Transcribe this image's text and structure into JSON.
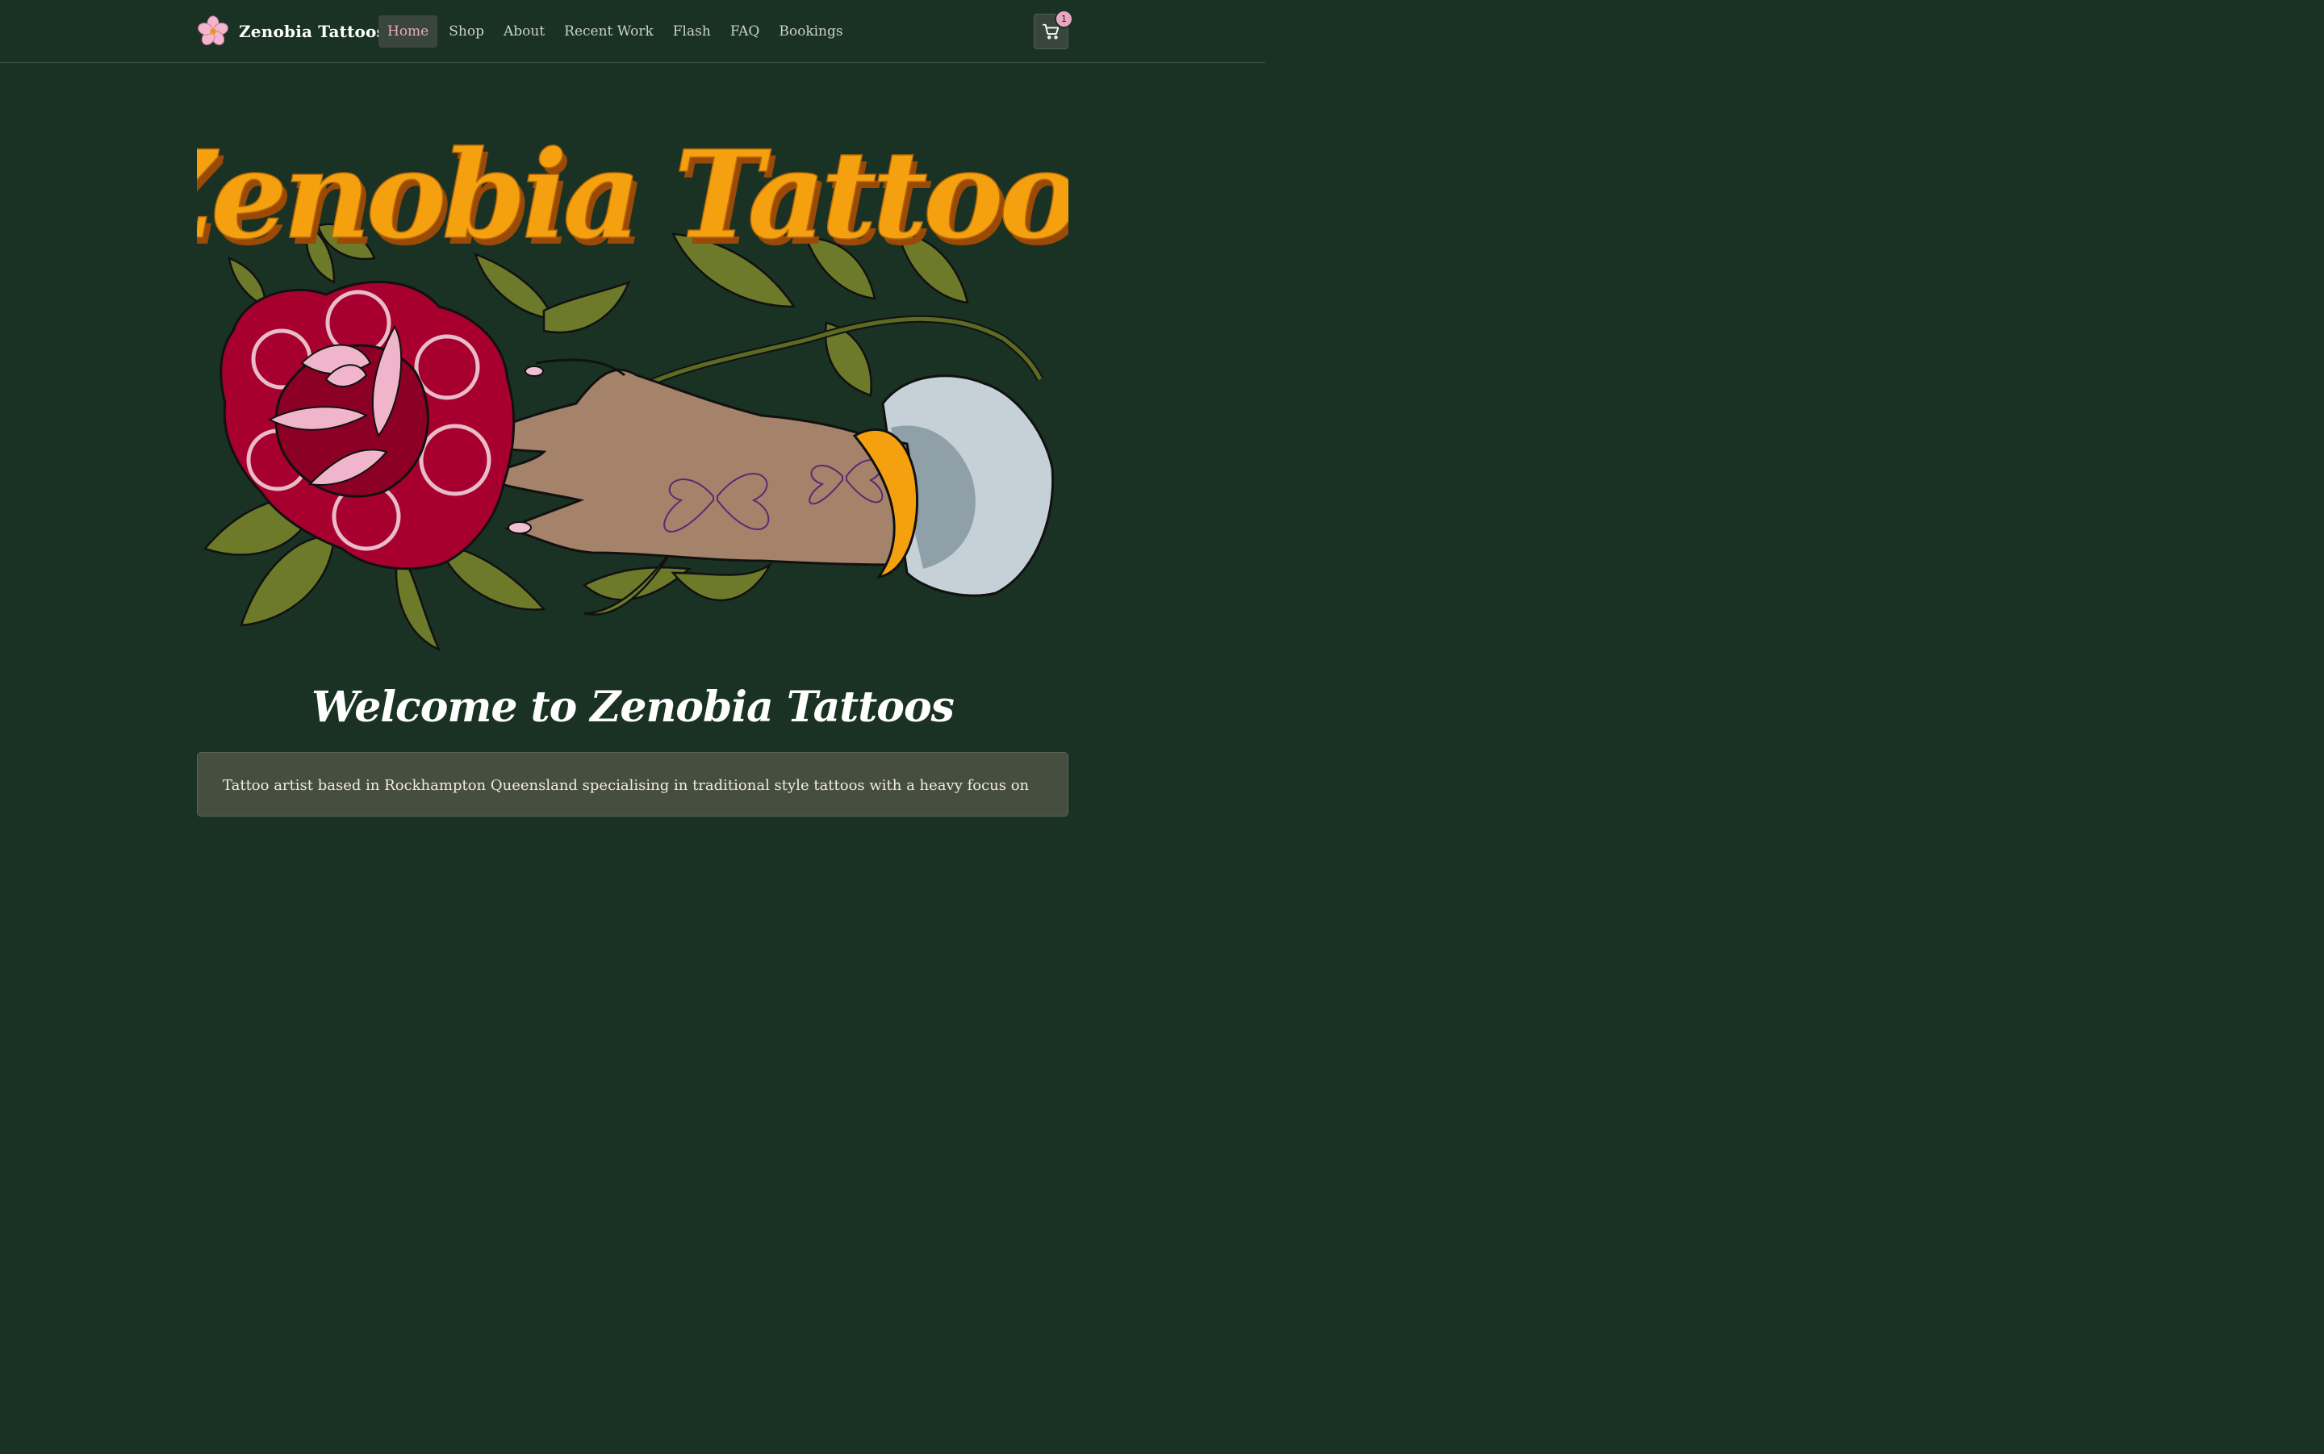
{
  "navbar": {
    "brand_name": "Zenobia Tattoos",
    "links": [
      {
        "label": "Home",
        "active": true
      },
      {
        "label": "Shop",
        "active": false
      },
      {
        "label": "About",
        "active": false
      },
      {
        "label": "Recent Work",
        "active": false
      },
      {
        "label": "Flash",
        "active": false
      },
      {
        "label": "FAQ",
        "active": false
      },
      {
        "label": "Bookings",
        "active": false
      }
    ],
    "cart_icon": "shopping-cart-icon",
    "cart_count": "1"
  },
  "hero": {
    "logo_lettering": "Zenobia Tattoos",
    "illustration": "hand-holding-rose-illustration"
  },
  "welcome": {
    "heading": "Welcome to Zenobia Tattoos"
  },
  "intro": {
    "text": "Tattoo artist based in Rockhampton Queensland specialising in traditional style tattoos with a heavy focus on"
  },
  "colors": {
    "background": "#1a3224",
    "accent_pink": "#e8a8c2",
    "logo_orange": "#f5a00f",
    "rose_red": "#a8002e",
    "card_bg": "#464e40"
  }
}
